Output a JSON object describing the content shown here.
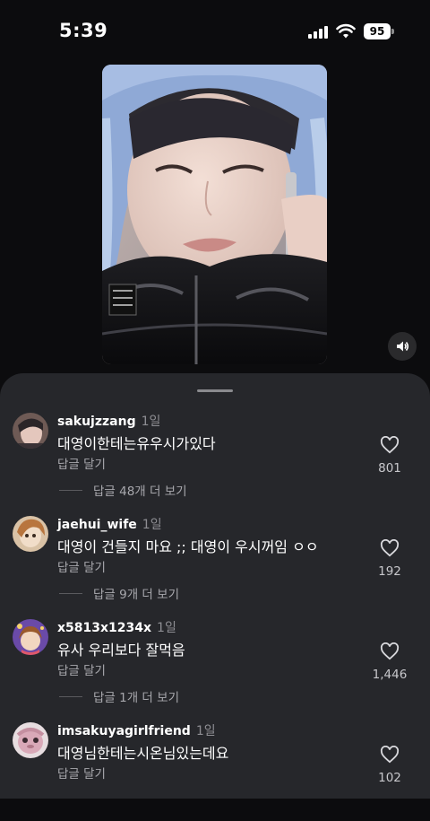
{
  "status": {
    "time": "5:39",
    "battery": "95"
  },
  "comments": [
    {
      "username": "sakujzzang",
      "time_ago": "1일",
      "text": "대영이한테는유우시가있다",
      "reply_label": "답글 달기",
      "view_replies": "답글 48개 더 보기",
      "likes": "801"
    },
    {
      "username": "jaehui_wife",
      "time_ago": "1일",
      "text": "대영이 건들지 마요 ;; 대영이 우시꺼임 ㅇㅇ",
      "reply_label": "답글 달기",
      "view_replies": "답글 9개 더 보기",
      "likes": "192"
    },
    {
      "username": "x5813x1234x",
      "time_ago": "1일",
      "text": "유사 우리보다 잘먹음",
      "reply_label": "답글 달기",
      "view_replies": "답글 1개 더 보기",
      "likes": "1,446"
    },
    {
      "username": "imsakuyagirlfriend",
      "time_ago": "1일",
      "text": "대영님한테는시온님있는데요",
      "reply_label": "답글 달기",
      "likes": "102"
    }
  ],
  "icons": {
    "sound": "speaker-icon",
    "like": "heart-icon"
  }
}
